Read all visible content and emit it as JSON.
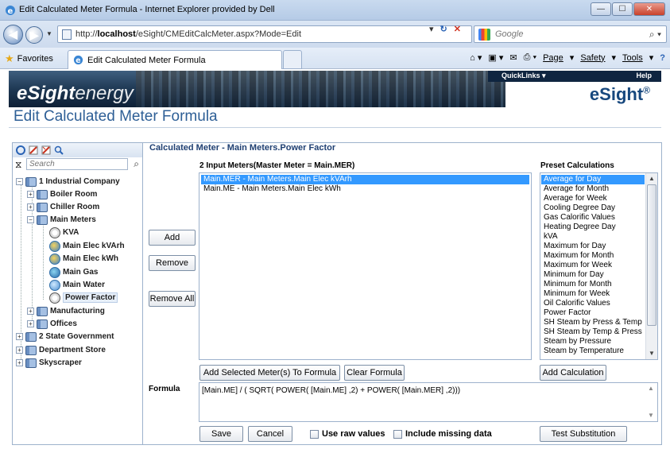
{
  "browser": {
    "window_title": "Edit Calculated Meter Formula - Internet Explorer provided by Dell",
    "url_prefix": "http://",
    "url_host": "localhost",
    "url_path": "/eSight/CMEditCalcMeter.aspx?Mode=Edit",
    "search_engine": "Google",
    "favorites_label": "Favorites",
    "tab_label": "Edit Calculated Meter Formula",
    "commands": {
      "page": "Page",
      "safety": "Safety",
      "tools": "Tools"
    }
  },
  "header": {
    "brand_bold": "eSight",
    "brand_light": "energy",
    "quicklinks": "QuickLinks",
    "help": "Help",
    "logo": "eSight",
    "logo_mark": "®"
  },
  "page_title": "Edit Calculated Meter Formula",
  "tree": {
    "search_placeholder": "Search",
    "nodes": [
      {
        "label": "1 Industrial Company"
      },
      {
        "label": "Boiler Room"
      },
      {
        "label": "Chiller Room"
      },
      {
        "label": "Main Meters"
      },
      {
        "label": "KVA"
      },
      {
        "label": "Main Elec kVArh"
      },
      {
        "label": "Main Elec kWh"
      },
      {
        "label": "Main Gas"
      },
      {
        "label": "Main Water"
      },
      {
        "label": "Power Factor"
      },
      {
        "label": "Manufacturing"
      },
      {
        "label": "Offices"
      },
      {
        "label": "2 State Government"
      },
      {
        "label": "Department Store"
      },
      {
        "label": "Skyscraper"
      }
    ]
  },
  "main": {
    "calc_meter_title": "Calculated Meter - Main Meters.Power Factor",
    "input_meters_label": "2 Input Meters(Master Meter = Main.MER)",
    "input_meters": [
      "Main.MER - Main Meters.Main Elec kVArh",
      "Main.ME - Main Meters.Main Elec kWh"
    ],
    "preset_label": "Preset Calculations",
    "presets": [
      "Average for Day",
      "Average for Month",
      "Average for Week",
      "Cooling Degree Day",
      "Gas Calorific Values",
      "Heating Degree Day",
      "kVA",
      "Maximum for Day",
      "Maximum for Month",
      "Maximum for Week",
      "Minimum for Day",
      "Minimum for Month",
      "Minimum for Week",
      "Oil Calorific Values",
      "Power Factor",
      "SH Steam by Press & Temp",
      "SH Steam by Temp & Press",
      "Steam by Pressure",
      "Steam by Temperature"
    ],
    "buttons": {
      "add": "Add",
      "remove": "Remove",
      "remove_all": "Remove All",
      "add_selected": "Add Selected Meter(s) To Formula",
      "clear_formula": "Clear Formula",
      "add_calculation": "Add Calculation",
      "save": "Save",
      "cancel": "Cancel",
      "test_substitution": "Test Substitution"
    },
    "formula_label": "Formula",
    "formula_value": "[Main.ME] / ( SQRT( POWER( [Main.ME] ,2) + POWER( [Main.MER] ,2)))",
    "use_raw_values": "Use raw values",
    "include_missing": "Include missing data"
  },
  "colors": {
    "accent_blue": "#2e5f96",
    "selection": "#3399ff",
    "title_navy": "#1e3f72"
  }
}
